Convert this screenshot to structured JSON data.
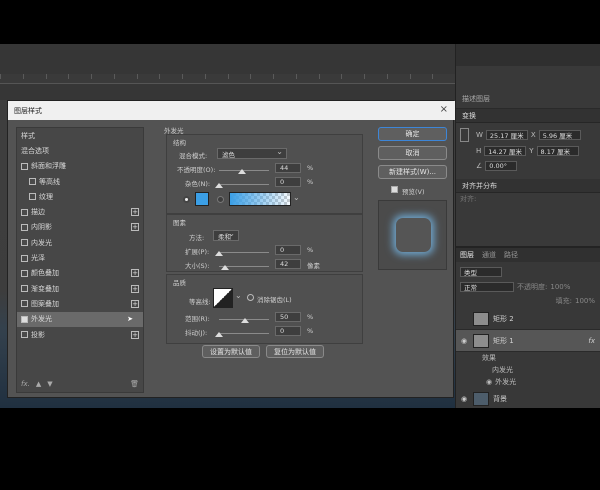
{
  "right_panel": {
    "tab_label": "描述图层",
    "transform_title": "变换",
    "w_label": "W",
    "w_value": "25.17 厘米",
    "x_label": "X",
    "x_value": "5.96 厘米",
    "h_label": "H",
    "h_value": "14.27 厘米",
    "y_label": "Y",
    "y_value": "8.17 厘米",
    "angle_value": "0.00°",
    "align_title": "对齐并分布",
    "align_sub": "对齐:",
    "layers_tabs": [
      "图层",
      "通道",
      "路径"
    ],
    "kind_label": "类型",
    "blend_mode": "正常",
    "opacity_label": "不透明度:",
    "opacity_value": "100%",
    "fill_label": "填充:",
    "fill_value": "100%",
    "layers": [
      {
        "name": "矩形 2"
      },
      {
        "name": "矩形 1",
        "fx": "fx"
      },
      {
        "name": "效果"
      },
      {
        "name": "内发光"
      },
      {
        "name": "外发光"
      },
      {
        "name": "背景"
      }
    ]
  },
  "dialog": {
    "title": "图层样式",
    "left_items": [
      {
        "label": "样式"
      },
      {
        "label": "混合选项"
      },
      {
        "label": "斜面和浮雕"
      },
      {
        "label": "等高线"
      },
      {
        "label": "纹理"
      },
      {
        "label": "描边"
      },
      {
        "label": "内阴影"
      },
      {
        "label": "内发光"
      },
      {
        "label": "光泽"
      },
      {
        "label": "颜色叠加"
      },
      {
        "label": "渐变叠加"
      },
      {
        "label": "图案叠加"
      },
      {
        "label": "外发光"
      },
      {
        "label": "投影"
      }
    ],
    "footer_fx": "fx.",
    "panel_title": "外发光",
    "structure_title": "结构",
    "blend_label": "混合模式:",
    "blend_value": "滤色",
    "opacity_label": "不透明度(O):",
    "opacity_value": "44",
    "noise_label": "杂色(N):",
    "noise_value": "0",
    "percent": "%",
    "elements_title": "图素",
    "method_label": "方法:",
    "method_value": "柔和",
    "spread_label": "扩展(P):",
    "spread_value": "0",
    "size_label": "大小(S):",
    "size_value": "42",
    "size_unit": "像素",
    "quality_title": "品质",
    "contour_label": "等高线:",
    "antialias_label": "消除锯齿(L)",
    "range_label": "范围(R):",
    "range_value": "50",
    "jitter_label": "抖动(J):",
    "jitter_value": "0",
    "set_default": "设置为默认值",
    "reset_default": "复位为默认值",
    "ok": "确定",
    "cancel": "取消",
    "new_style": "新建样式(W)...",
    "preview": "预览(V)",
    "accent_color": "#3b9fe6"
  }
}
